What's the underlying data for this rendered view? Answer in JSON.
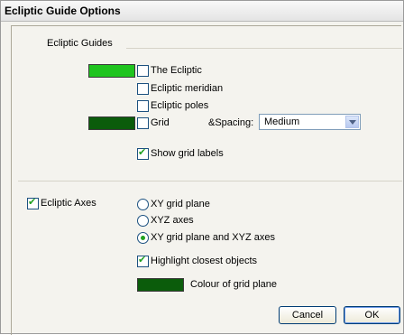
{
  "dialog": {
    "title": "Ecliptic Guide Options"
  },
  "ecliptic_guides": {
    "section_label": "Ecliptic Guides",
    "items": {
      "the_ecliptic": {
        "label": "The Ecliptic",
        "checked": false,
        "swatch_color": "#1fc41f"
      },
      "ecliptic_meridian": {
        "label": "Ecliptic meridian",
        "checked": false
      },
      "ecliptic_poles": {
        "label": "Ecliptic poles",
        "checked": false
      },
      "grid": {
        "label": "Grid",
        "checked": false,
        "swatch_color": "#0b5c0b"
      }
    },
    "spacing": {
      "label": "&Spacing:",
      "value": "Medium"
    },
    "show_grid_labels": {
      "label": "Show grid labels",
      "checked": true
    }
  },
  "ecliptic_axes": {
    "label": "Ecliptic Axes",
    "checked": true,
    "options": [
      {
        "label": "XY grid plane",
        "selected": false
      },
      {
        "label": "XYZ axes",
        "selected": false
      },
      {
        "label": "XY grid plane and XYZ axes",
        "selected": true
      }
    ],
    "highlight_closest": {
      "label": "Highlight closest objects",
      "checked": true
    },
    "grid_plane_colour": {
      "label": "Colour of grid plane",
      "swatch_color": "#0b5c0b"
    }
  },
  "buttons": {
    "cancel": "Cancel",
    "ok": "OK"
  },
  "colors": {
    "check_mark": "#21a121",
    "control_border": "#1c5180"
  }
}
